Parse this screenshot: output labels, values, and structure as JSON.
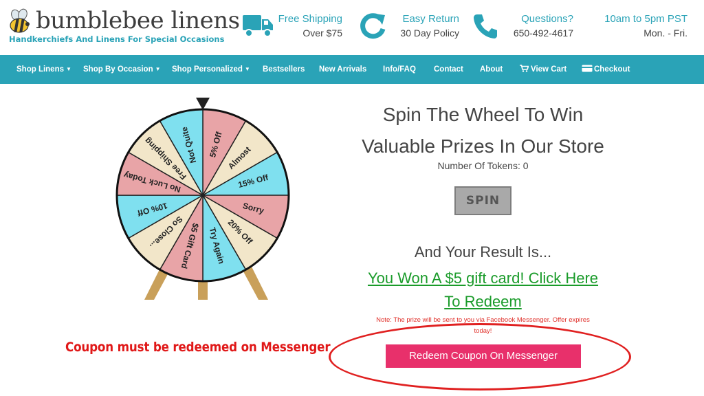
{
  "brand": {
    "name": "bumblebee linens",
    "tagline": "Handkerchiefs And Linens For Special Occasions"
  },
  "header_info": [
    {
      "icon": "truck-icon",
      "title": "Free Shipping",
      "sub": "Over $75"
    },
    {
      "icon": "return-icon",
      "title": "Easy Return",
      "sub": "30 Day Policy"
    },
    {
      "icon": "phone-icon",
      "title": "Questions?",
      "sub": "650-492-4617"
    },
    {
      "icon": "",
      "title": "10am to 5pm PST",
      "sub": "Mon. - Fri."
    }
  ],
  "nav": {
    "items": [
      {
        "label": "Shop Linens",
        "dropdown": true
      },
      {
        "label": "Shop By Occasion",
        "dropdown": true
      },
      {
        "label": "Shop Personalized",
        "dropdown": true
      },
      {
        "label": "Bestsellers",
        "dropdown": false
      },
      {
        "label": "New Arrivals",
        "dropdown": false
      },
      {
        "label": "Info/FAQ",
        "dropdown": false
      },
      {
        "label": "Contact",
        "dropdown": false
      },
      {
        "label": "About",
        "dropdown": false
      },
      {
        "label": "View Cart",
        "icon": "cart-icon"
      },
      {
        "label": "Checkout",
        "icon": "credit-card-icon"
      }
    ]
  },
  "wheel": {
    "segments": [
      {
        "label": "5% Off",
        "color": "#e8a4a7"
      },
      {
        "label": "Almost",
        "color": "#f2e6c9"
      },
      {
        "label": "15% Off",
        "color": "#7fe0ef"
      },
      {
        "label": "Sorry",
        "color": "#e8a4a7"
      },
      {
        "label": "20% Off",
        "color": "#f2e6c9"
      },
      {
        "label": "Try Again",
        "color": "#7fe0ef"
      },
      {
        "label": "$5 Gift Card",
        "color": "#e8a4a7"
      },
      {
        "label": "So Close...",
        "color": "#f2e6c9"
      },
      {
        "label": "10% Off",
        "color": "#7fe0ef"
      },
      {
        "label": "No Luck Today",
        "color": "#e8a4a7"
      },
      {
        "label": "Free Shipping",
        "color": "#f2e6c9"
      },
      {
        "label": "Not Quite",
        "color": "#7fe0ef"
      }
    ]
  },
  "game": {
    "title_line1": "Spin The Wheel To Win",
    "title_line2": "Valuable Prizes In Our Store",
    "tokens_label": "Number Of Tokens: 0",
    "spin_label": "SPIN",
    "result_label": "And Your Result Is...",
    "result_line1": "You Won A $5 gift card! Click Here",
    "result_line2": "To Redeem",
    "note_line1": "Note: The prize will be sent to you via Facebook Messenger. Offer expires",
    "note_line2": "today!",
    "redeem_label": "Redeem Coupon On Messenger"
  },
  "annotation": "Coupon must be redeemed on Messenger",
  "colors": {
    "accent": "#2aa3b7",
    "link_green": "#1a9b2a",
    "redeem_pink": "#e8306b",
    "annotation_red": "#e01818"
  }
}
